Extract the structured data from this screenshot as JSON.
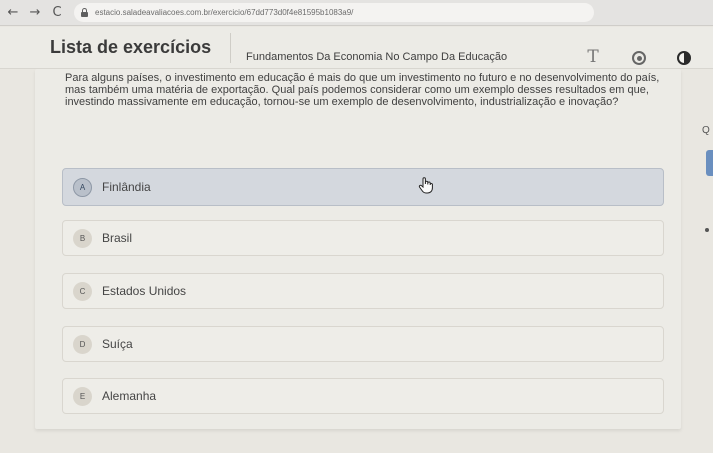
{
  "browser": {
    "back_icon": "←",
    "forward_icon": "→",
    "reload_icon": "C",
    "url": "estacio.saladeavaliacoes.com.br/exercicio/67dd773d0f4e81595b1083a9/"
  },
  "header": {
    "title": "Lista de exercícios",
    "course": "Fundamentos Da Economia No Campo Da Educação",
    "font_icon_glyph": "T"
  },
  "question": {
    "text": "Para alguns países, o investimento em educação é mais do que um investimento no futuro e no desenvolvimento do país, mas também uma matéria de exportação. Qual país podemos considerar como um exemplo desses resultados em que, investindo massivamente em educação, tornou-se um exemplo de desenvolvimento, industrialização e inovação?"
  },
  "options": [
    {
      "letter": "A",
      "label": "Finlândia",
      "selected": true
    },
    {
      "letter": "B",
      "label": "Brasil",
      "selected": false
    },
    {
      "letter": "C",
      "label": "Estados Unidos",
      "selected": false
    },
    {
      "letter": "D",
      "label": "Suíça",
      "selected": false
    },
    {
      "letter": "E",
      "label": "Alemanha",
      "selected": false
    }
  ],
  "side": {
    "fragment": "Q"
  },
  "colors": {
    "selected_bg": "#d4d8de",
    "accent_blue": "#6a8fbf"
  }
}
